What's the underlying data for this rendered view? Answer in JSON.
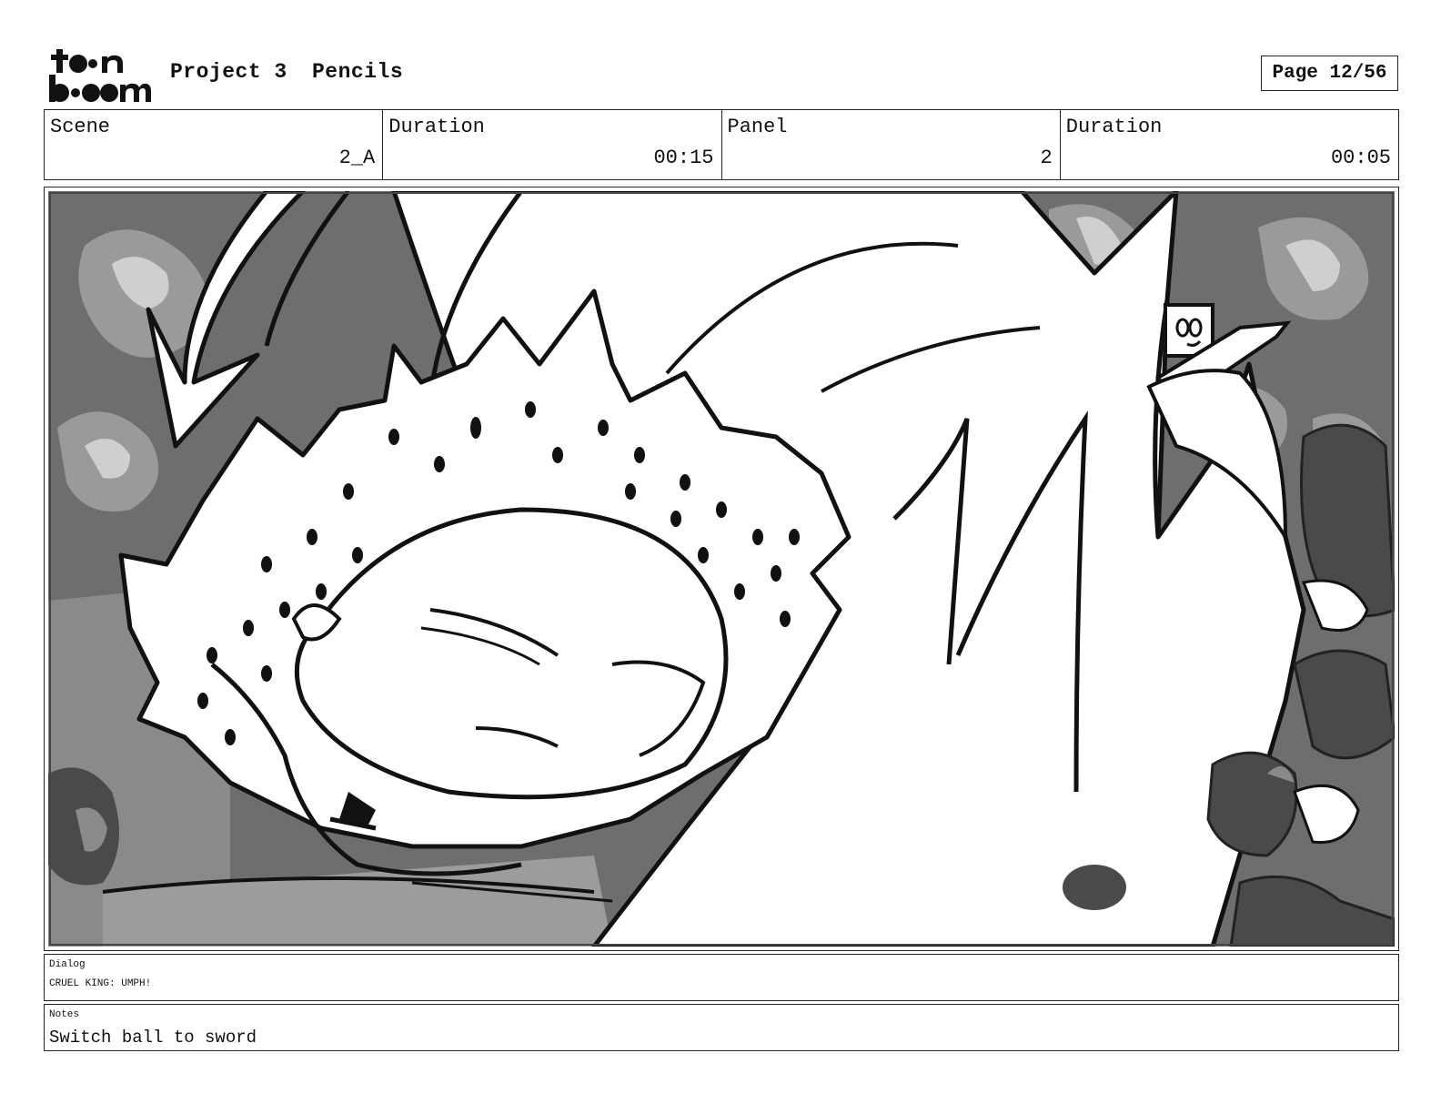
{
  "header": {
    "logo_top": "to•n",
    "logo_bottom": "b••m",
    "project": "Project 3",
    "stage": "Pencils",
    "page": "Page 12/56"
  },
  "info": {
    "scene_label": "Scene",
    "scene_value": "2_A",
    "scene_duration_label": "Duration",
    "scene_duration_value": "00:15",
    "panel_label": "Panel",
    "panel_value": "2",
    "panel_duration_label": "Duration",
    "panel_duration_value": "00:05"
  },
  "dialog": {
    "label": "Dialog",
    "text": "CRUEL KING: UMPH!"
  },
  "notes": {
    "label": "Notes",
    "text": "Switch ball to sword"
  }
}
